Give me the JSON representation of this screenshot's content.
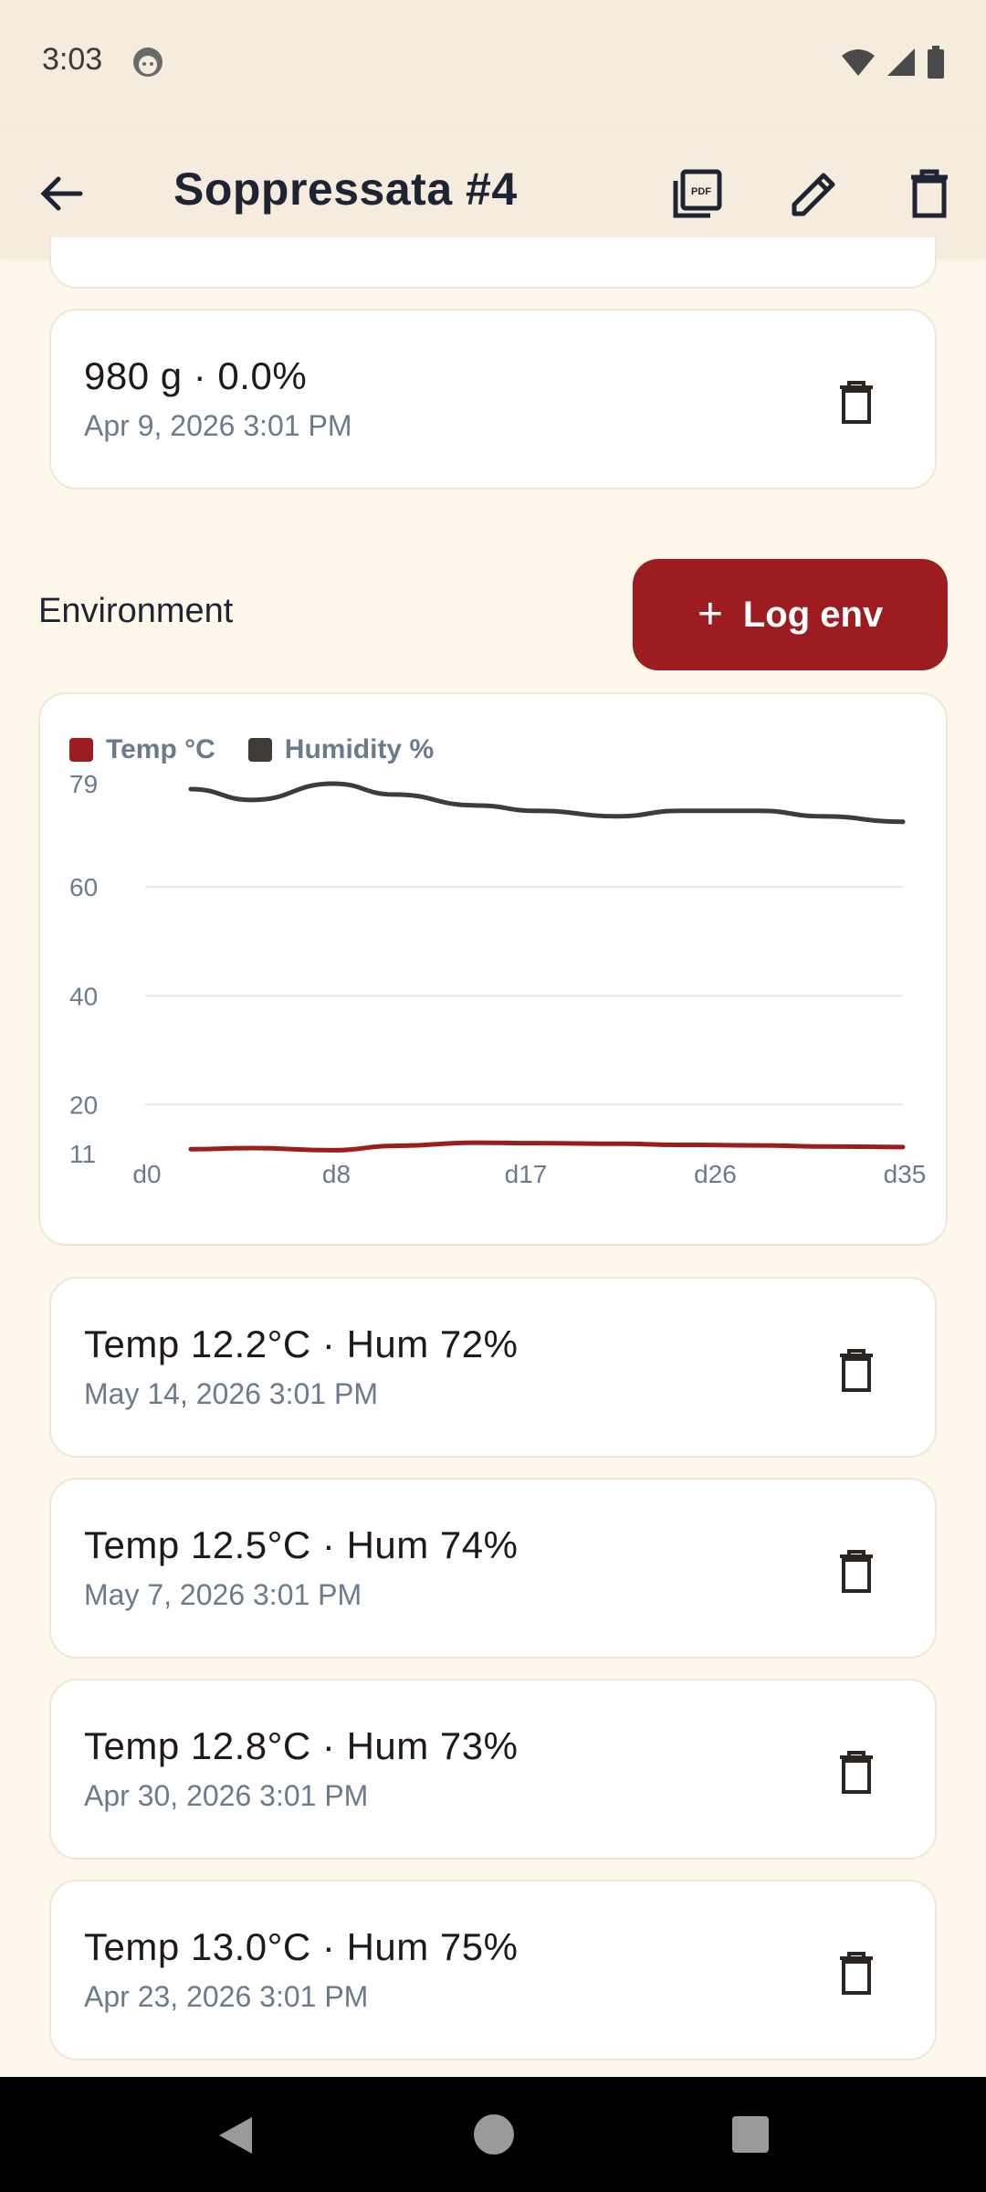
{
  "status_bar": {
    "time": "3:03"
  },
  "app_bar": {
    "title": "Soppressata #4",
    "icons": [
      "arrow-back-icon",
      "pdf-icon",
      "edit-icon",
      "delete-icon"
    ]
  },
  "weight_entry": {
    "main": "980 g  ·  0.0%",
    "date": "Apr 9, 2026 3:01 PM"
  },
  "environment": {
    "label": "Environment",
    "log_button": "Log env"
  },
  "chart_data": {
    "type": "line",
    "legend": [
      "Temp °C",
      "Humidity %"
    ],
    "x_ticks": [
      "d0",
      "d8",
      "d17",
      "d26",
      "d35"
    ],
    "y_ticks": [
      "79",
      "60",
      "40",
      "20",
      "11"
    ],
    "ylim": [
      11,
      79
    ],
    "xlim": [
      0,
      35
    ],
    "grid": true,
    "colors": {
      "temp": "#9c1c1f",
      "humidity": "#3f3c38"
    },
    "series": [
      {
        "name": "Temp °C",
        "x": [
          0,
          3,
          7,
          10,
          14,
          17,
          21,
          24,
          28,
          31,
          35
        ],
        "values": [
          11.8,
          12.0,
          11.6,
          12.4,
          13.0,
          12.9,
          12.8,
          12.6,
          12.5,
          12.3,
          12.2
        ]
      },
      {
        "name": "Humidity %",
        "x": [
          0,
          3,
          7,
          10,
          14,
          17,
          21,
          24,
          28,
          31,
          35
        ],
        "values": [
          78,
          76,
          79,
          77,
          75,
          74,
          73,
          74,
          74,
          73,
          72
        ]
      }
    ]
  },
  "env_entries": [
    {
      "main": "Temp 12.2°C  ·  Hum 72%",
      "date": "May 14, 2026 3:01 PM"
    },
    {
      "main": "Temp 12.5°C  ·  Hum 74%",
      "date": "May 7, 2026 3:01 PM"
    },
    {
      "main": "Temp 12.8°C  ·  Hum 73%",
      "date": "Apr 30, 2026 3:01 PM"
    },
    {
      "main": "Temp 13.0°C  ·  Hum 75%",
      "date": "Apr 23, 2026 3:01 PM"
    }
  ]
}
